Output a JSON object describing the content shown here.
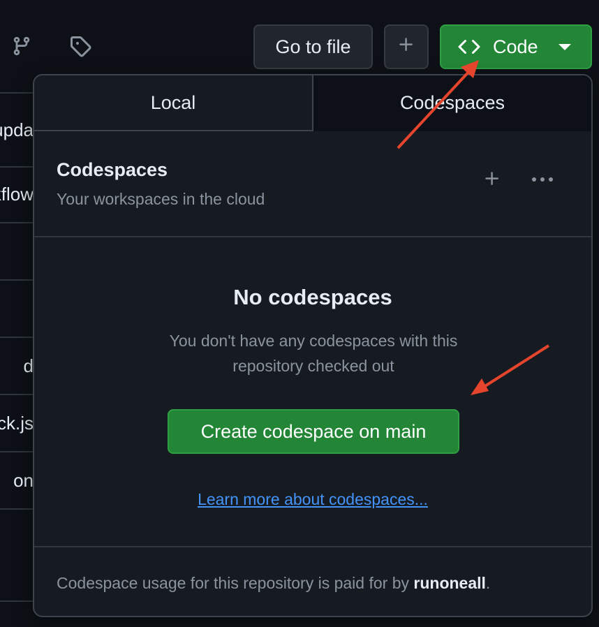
{
  "toolbar": {
    "go_to_file": "Go to file",
    "add": "+",
    "code_label": "Code"
  },
  "background_rows": [
    "upda",
    "kflow",
    "",
    "",
    "d",
    "ck.js",
    "on",
    ""
  ],
  "tabs": [
    {
      "label": "Local"
    },
    {
      "label": "Codespaces"
    }
  ],
  "codespaces": {
    "title": "Codespaces",
    "subtitle": "Your workspaces in the cloud",
    "empty_title": "No codespaces",
    "empty_desc": "You don't have any codespaces with this repository checked out",
    "create_button": "Create codespace on main",
    "learn_more": "Learn more about codespaces...",
    "footer_prefix": "Codespace usage for this repository is paid for by ",
    "footer_owner": "runoneall",
    "footer_suffix": "."
  },
  "colors": {
    "accent_green": "#238636",
    "link_blue": "#4493f8",
    "annotation_red": "#e5442d"
  },
  "icons": [
    "branch-icon",
    "tag-icon",
    "plus-icon",
    "code-brackets-icon",
    "caret-down-icon",
    "kebab-icon"
  ]
}
